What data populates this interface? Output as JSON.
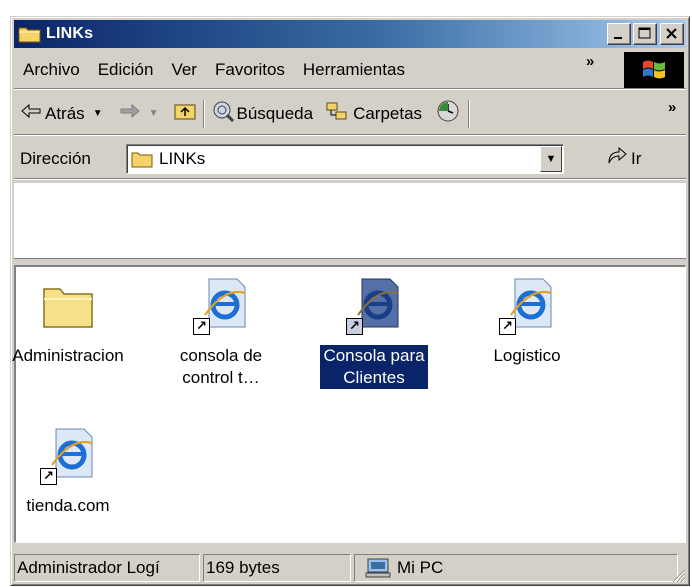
{
  "window": {
    "title": "LINKs",
    "min_label": "_",
    "close_label": "✕"
  },
  "menubar": {
    "items": [
      "Archivo",
      "Edición",
      "Ver",
      "Favoritos",
      "Herramientas"
    ],
    "chevron": "»"
  },
  "toolbar": {
    "back_label": "Atrás",
    "search_label": "Búsqueda",
    "folders_label": "Carpetas",
    "chevron": "»"
  },
  "addressbar": {
    "label": "Dirección",
    "value": "LINKs",
    "go_label": "Ir"
  },
  "content": {
    "items": [
      {
        "label": "Administracion",
        "type": "folder",
        "selected": false
      },
      {
        "label_line1": "consola de",
        "label_line2": "control t…",
        "type": "shortcut",
        "selected": false
      },
      {
        "label_line1": "Consola para",
        "label_line2": "Clientes",
        "type": "shortcut",
        "selected": true
      },
      {
        "label": "Logistico",
        "type": "shortcut",
        "selected": false
      },
      {
        "label": "tienda.com",
        "type": "shortcut",
        "selected": false
      }
    ]
  },
  "statusbar": {
    "panel1": "Administrador Logí",
    "panel2": "169 bytes",
    "panel3": "Mi PC"
  },
  "icons": {
    "folder": "folder-icon",
    "internet_shortcut": "ie-shortcut-icon",
    "computer": "my-computer-icon"
  },
  "colors": {
    "titlebar_start": "#0a246a",
    "titlebar_end": "#a6caf0",
    "selection": "#0a246a",
    "chrome": "#d4d0c8"
  }
}
